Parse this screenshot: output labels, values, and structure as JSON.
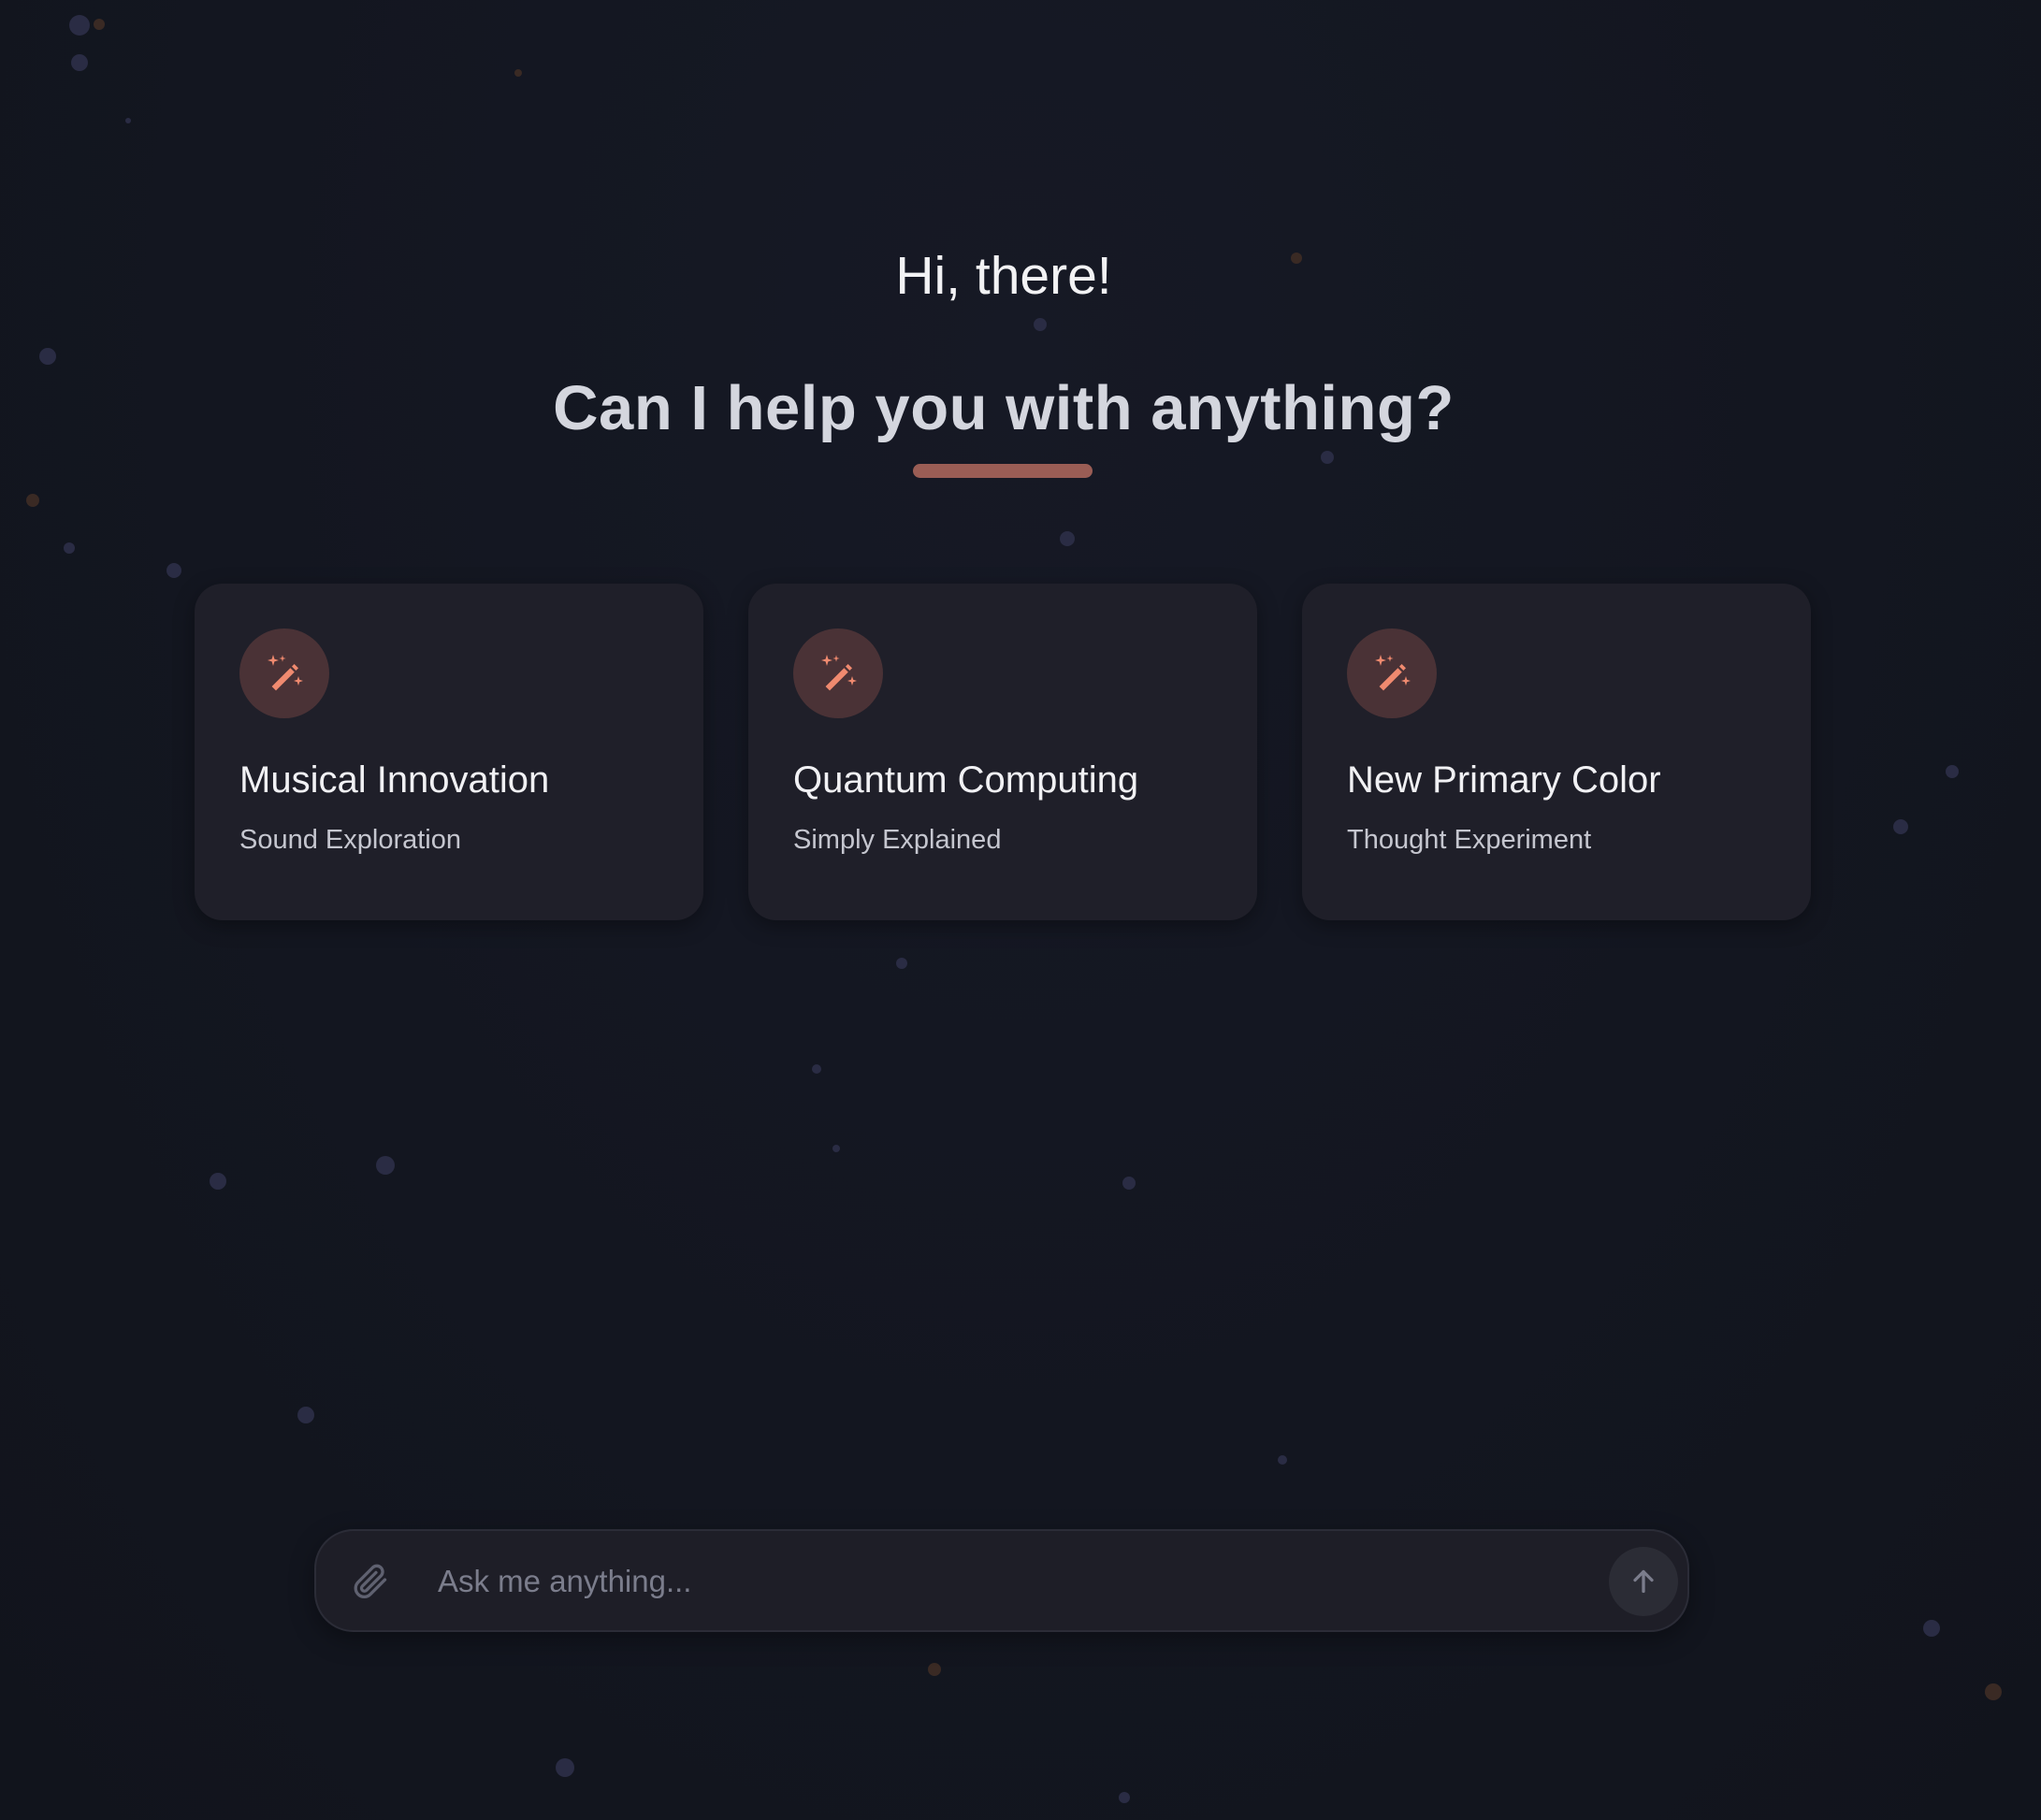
{
  "hero": {
    "greeting": "Hi, there!",
    "headline": "Can I help you with anything?"
  },
  "suggestions": [
    {
      "icon": "magic-wand-icon",
      "title": "Musical Innovation",
      "subtitle": "Sound Exploration"
    },
    {
      "icon": "magic-wand-icon",
      "title": "Quantum Computing",
      "subtitle": "Simply Explained"
    },
    {
      "icon": "magic-wand-icon",
      "title": "New Primary Color",
      "subtitle": "Thought Experiment"
    }
  ],
  "composer": {
    "placeholder": "Ask me anything...",
    "attach_icon": "paperclip-icon",
    "send_icon": "arrow-up-icon"
  },
  "colors": {
    "background": "#131620",
    "card": "#1f1f29",
    "accent": "#f08a6f",
    "accent_underline": "#9a5d55",
    "icon_circle": "#4a3236"
  }
}
